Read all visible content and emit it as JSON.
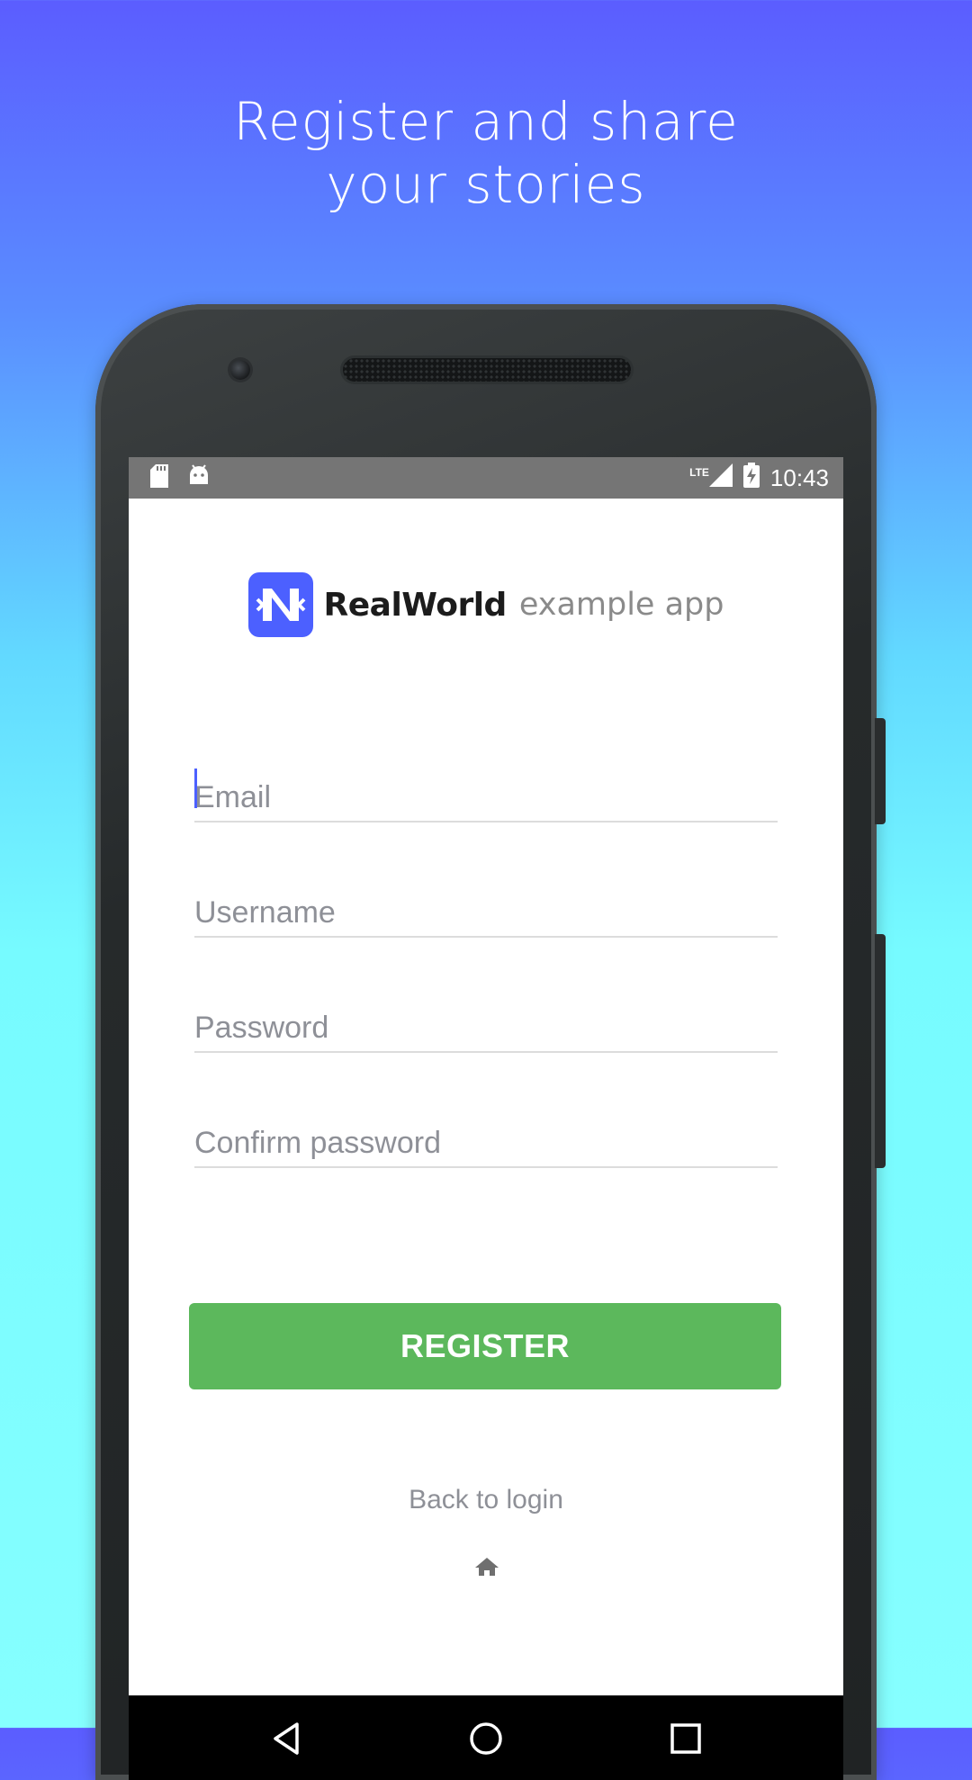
{
  "headline": {
    "line1": "Register and share",
    "line2": "your stories"
  },
  "status_bar": {
    "network": "LTE",
    "time": "10:43"
  },
  "logo": {
    "bold": "RealWorld",
    "light": "example app",
    "mark_color": "#4c60ff"
  },
  "form": {
    "email_placeholder": "Email",
    "username_placeholder": "Username",
    "password_placeholder": "Password",
    "confirm_placeholder": "Confirm password",
    "register_label": "REGISTER",
    "back_label": "Back to login"
  },
  "colors": {
    "accent": "#4c60ff",
    "button": "#5cb85c",
    "placeholder": "#8e9097"
  },
  "icons": {
    "status_left": [
      "sd-card-icon",
      "android-icon"
    ],
    "status_right": [
      "signal-icon",
      "battery-charging-icon"
    ],
    "nav": [
      "back-icon",
      "home-icon",
      "recents-icon"
    ],
    "footer": "home-icon"
  }
}
